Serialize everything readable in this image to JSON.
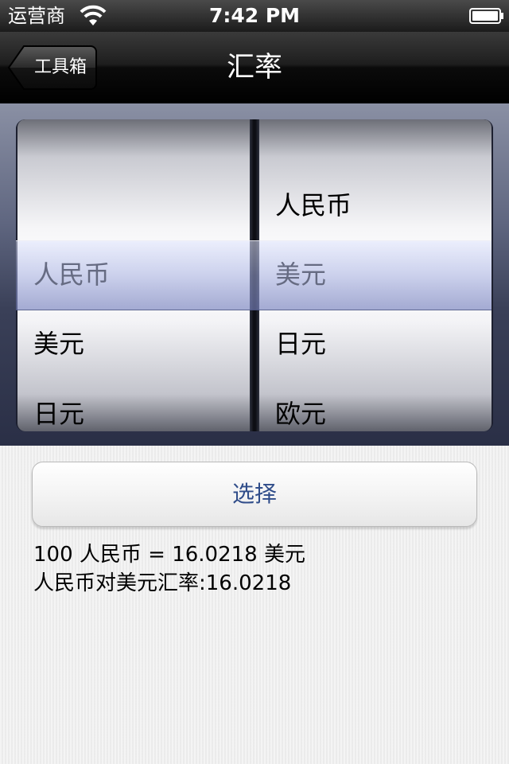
{
  "status_bar": {
    "carrier": "运营商",
    "time": "7:42 PM"
  },
  "navbar": {
    "back_label": "工具箱",
    "title": "汇率"
  },
  "picker": {
    "left_wheel": {
      "selected": "人民币",
      "items_below": [
        "美元",
        "日元"
      ]
    },
    "right_wheel": {
      "item_above": "人民币",
      "selected": "美元",
      "items_below": [
        "日元",
        "欧元"
      ]
    }
  },
  "actions": {
    "select_label": "选择"
  },
  "result": {
    "line1": "100 人民币 = 16.0218 美元",
    "line2": "人民币对美元汇率:16.0218"
  },
  "colors": {
    "button_text": "#304d8a",
    "navbar": "#000000",
    "picker_highlight": "#a0aadc"
  }
}
